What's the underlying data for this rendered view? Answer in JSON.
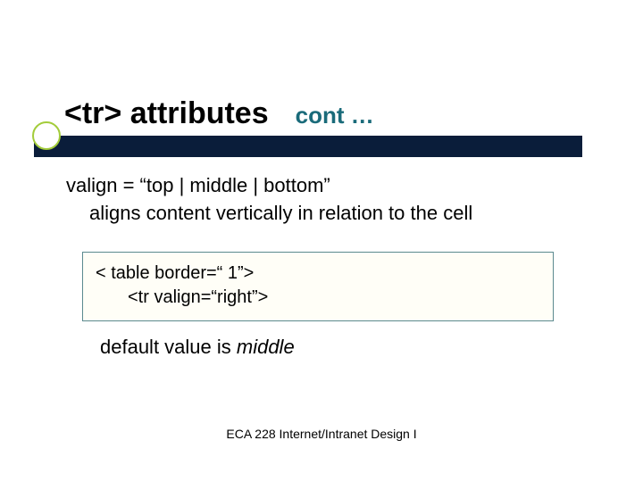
{
  "title": {
    "main": "<tr> attributes",
    "cont": "cont …"
  },
  "body": {
    "line1": "valign = “top | middle | bottom”",
    "line2": "aligns content vertically in relation to the cell"
  },
  "code": {
    "line1": "< table border=“ 1”>",
    "line2": "<tr valign=“right”>"
  },
  "default_note": {
    "prefix": "default value is ",
    "value": "middle"
  },
  "footer": "ECA 228  Internet/Intranet Design I"
}
